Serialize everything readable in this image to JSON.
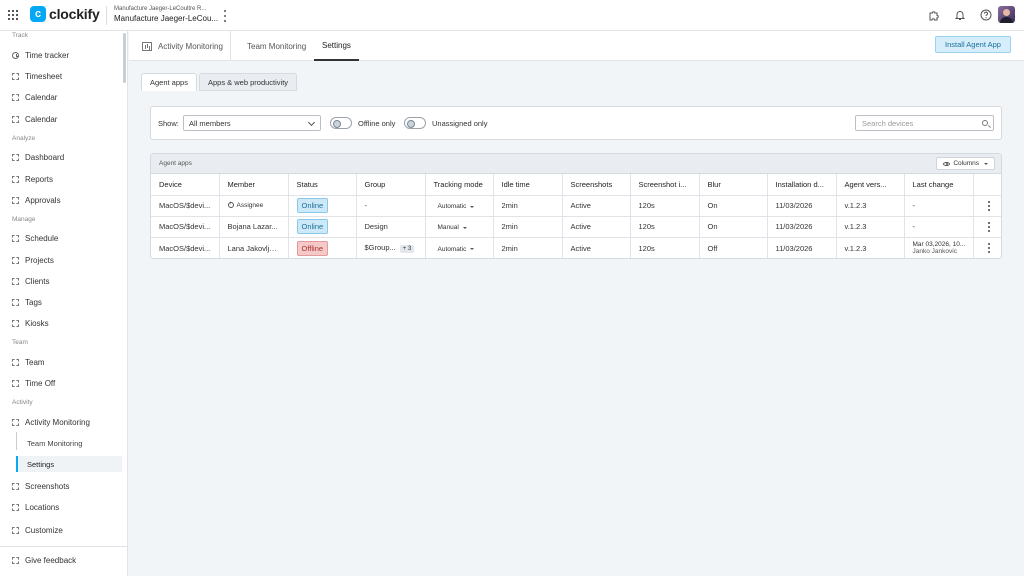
{
  "app": {
    "name": "clockify",
    "logo_letter": "c",
    "brand_color": "#03a9f4"
  },
  "workspace": {
    "subtitle": "Manufacture Jaeger-LeCoultre R...",
    "name": "Manufacture Jaeger-LeCou..."
  },
  "topbar_icons": [
    "apps-grid-icon",
    "puzzle-icon",
    "bell-icon",
    "help-icon",
    "avatar"
  ],
  "sidebar": {
    "sections": {
      "track": "Track",
      "analyze": "Analyze",
      "manage": "Manage",
      "team": "Team",
      "activity": "Activity"
    },
    "items": {
      "time_tracker": "Time tracker",
      "timesheet": "Timesheet",
      "calendar1": "Calendar",
      "calendar2": "Calendar",
      "dashboard": "Dashboard",
      "reports": "Reports",
      "approvals": "Approvals",
      "schedule": "Schedule",
      "projects": "Projects",
      "clients": "Clients",
      "tags": "Tags",
      "kiosks": "Kiosks",
      "team": "Team",
      "time_off": "Time Off",
      "activity_monitoring": "Activity Monitoring",
      "team_monitoring": "Team Monitoring",
      "settings": "Settings",
      "screenshots": "Screenshots",
      "locations": "Locations",
      "customize": "Customize",
      "give_feedback": "Give feedback"
    },
    "active": "settings"
  },
  "header": {
    "tabs": [
      "Activity Monitoring",
      "Team Monitoring",
      "Settings"
    ],
    "active_tab": "Settings",
    "install_button": "Install Agent App"
  },
  "subtabs": {
    "agent_apps": "Agent apps",
    "apps_web": "Apps & web productivity",
    "active": "Agent apps"
  },
  "filters": {
    "show_label": "Show:",
    "members_value": "All members",
    "offline_only": "Offline only",
    "offline_only_on": false,
    "unassigned_only": "Unassigned only",
    "unassigned_only_on": false,
    "search_placeholder": "Search devices"
  },
  "table": {
    "title": "Agent apps",
    "columns_button": "Columns",
    "headers": [
      "Device",
      "Member",
      "Status",
      "Group",
      "Tracking mode",
      "Idle time",
      "Screenshots",
      "Screenshot i...",
      "Blur",
      "Installation d...",
      "Agent vers...",
      "Last change"
    ],
    "rows": [
      {
        "device": "MacOS/$devi...",
        "member": "Assignee",
        "status": "Online",
        "group": "-",
        "group_more": "",
        "tracking_mode": "Automatic",
        "idle_time": "2min",
        "screenshots": "Active",
        "screenshot_interval": "120s",
        "blur": "On",
        "install_date": "11/03/2026",
        "agent_version": "v.1.2.3",
        "last_change": "-",
        "last_change_user": ""
      },
      {
        "device": "MacOS/$devi...",
        "member": "Bojana Lazar...",
        "status": "Online",
        "group": "Design",
        "group_more": "",
        "tracking_mode": "Manual",
        "idle_time": "2min",
        "screenshots": "Active",
        "screenshot_interval": "120s",
        "blur": "On",
        "install_date": "11/03/2026",
        "agent_version": "v.1.2.3",
        "last_change": "-",
        "last_change_user": ""
      },
      {
        "device": "MacOS/$devi...",
        "member": "Lana Jakovlje...",
        "status": "Offline",
        "group": "$Group...",
        "group_more": "+ 3",
        "tracking_mode": "Automatic",
        "idle_time": "2min",
        "screenshots": "Active",
        "screenshot_interval": "120s",
        "blur": "Off",
        "install_date": "11/03/2026",
        "agent_version": "v.1.2.3",
        "last_change": "Mar 03,2026, 10...",
        "last_change_user": "Janko Jankovic"
      }
    ]
  },
  "colors": {
    "online": "#cde9f7",
    "offline": "#f6c9c9",
    "accent": "#03a9f4"
  }
}
